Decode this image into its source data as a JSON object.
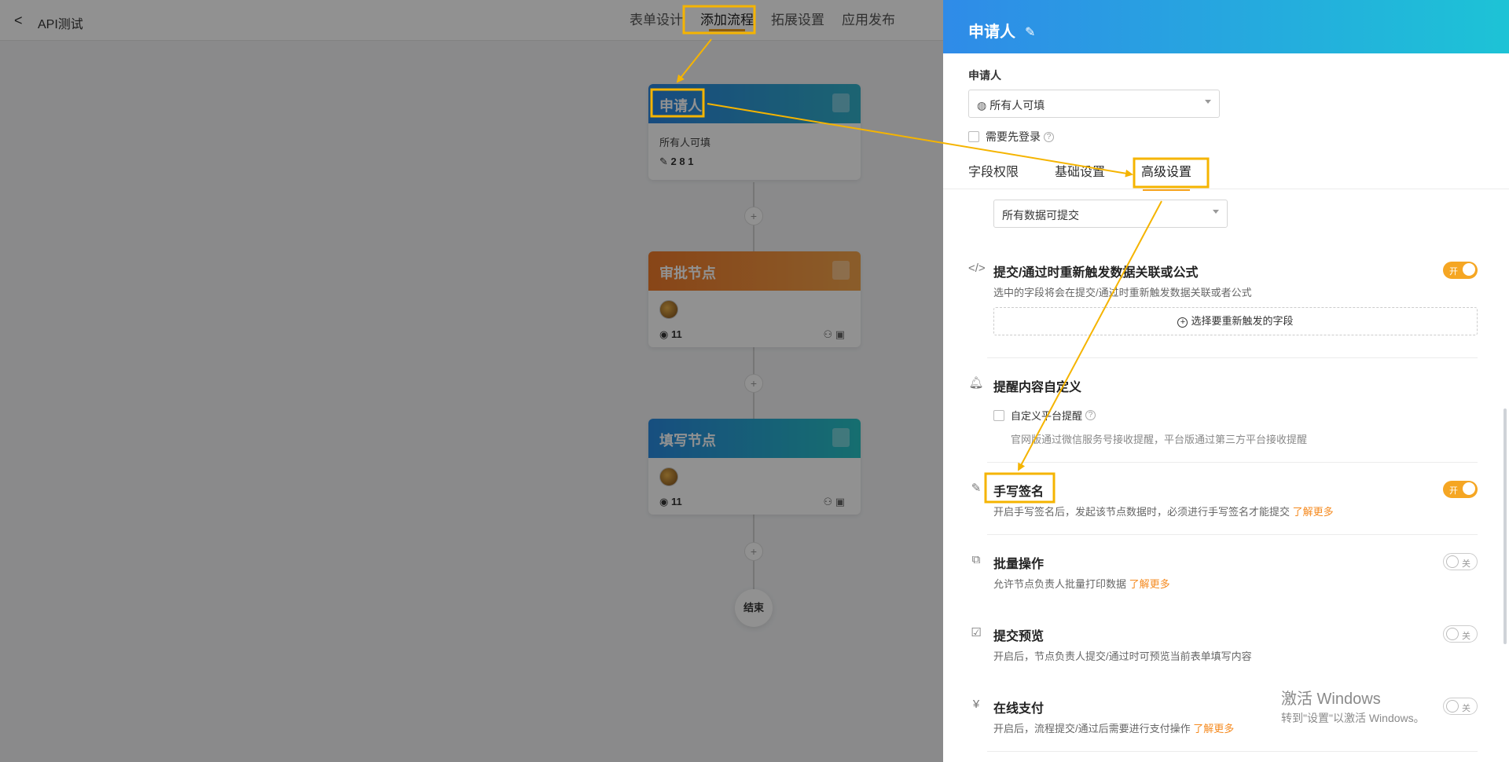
{
  "app": {
    "title": "API测试"
  },
  "nav": {
    "tabs": [
      "表单设计",
      "添加流程",
      "拓展设置",
      "应用发布"
    ]
  },
  "flow": {
    "applicant": {
      "title": "申请人",
      "subtitle": "所有人可填",
      "stats": "2  8  1"
    },
    "approve": {
      "title": "审批节点",
      "count": "11"
    },
    "fill": {
      "title": "填写节点",
      "count": "11"
    },
    "end": "结束",
    "plus": "+"
  },
  "drawer": {
    "title": "申请人",
    "field_label": "申请人",
    "applicant_select": "所有人可填",
    "need_login": "需要先登录",
    "tabs": [
      "字段权限",
      "基础设置",
      "高级设置"
    ],
    "submit_select": "所有数据可提交",
    "trigger": {
      "title": "提交/通过时重新触发数据关联或公式",
      "desc": "选中的字段将会在提交/通过时重新触发数据关联或者公式",
      "button": "选择要重新触发的字段",
      "state": "开"
    },
    "reminder": {
      "title": "提醒内容自定义",
      "checkbox": "自定义平台提醒",
      "desc": "官网版通过微信服务号接收提醒，平台版通过第三方平台接收提醒"
    },
    "signature": {
      "title": "手写签名",
      "desc": "开启手写签名后，发起该节点数据时，必须进行手写签名才能提交",
      "link": "了解更多",
      "state": "开"
    },
    "batch": {
      "title": "批量操作",
      "desc": "允许节点负责人批量打印数据",
      "link": "了解更多",
      "state": "关"
    },
    "preview": {
      "title": "提交预览",
      "desc": "开启后，节点负责人提交/通过时可预览当前表单填写内容",
      "state": "关"
    },
    "payment": {
      "title": "在线支付",
      "desc": "开启后，流程提交/通过后需要进行支付操作",
      "link": "了解更多",
      "state": "关"
    }
  },
  "watermark": {
    "line1": "激活 Windows",
    "line2": "转到\"设置\"以激活 Windows。"
  },
  "colors": {
    "accent": "#f7a21b",
    "annotation": "#f5b400",
    "toggle_on": "#f5a623"
  }
}
